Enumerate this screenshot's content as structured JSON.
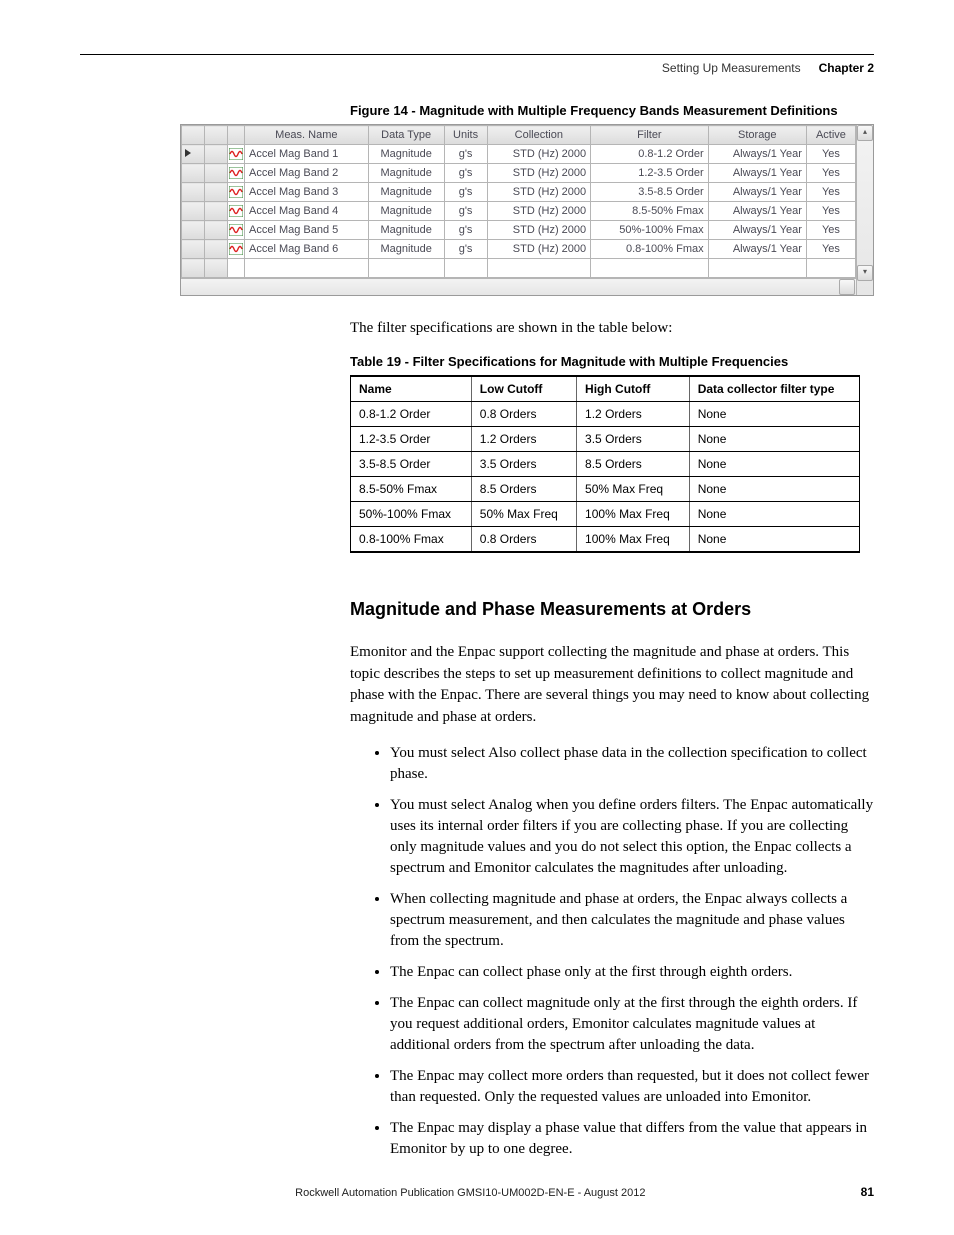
{
  "header": {
    "section": "Setting Up Measurements",
    "chapter": "Chapter 2"
  },
  "figure14": {
    "caption": "Figure 14 - Magnitude with Multiple Frequency Bands Measurement Definitions",
    "columns": [
      "Meas. Name",
      "Data Type",
      "Units",
      "Collection",
      "Filter",
      "Storage",
      "Active"
    ],
    "rows": [
      {
        "name": "Accel Mag Band 1",
        "dtype": "Magnitude",
        "units": "g's",
        "coll": "STD (Hz)  2000",
        "filter": "0.8-1.2 Order",
        "storage": "Always/1 Year",
        "active": "Yes",
        "selected": true
      },
      {
        "name": "Accel Mag Band 2",
        "dtype": "Magnitude",
        "units": "g's",
        "coll": "STD (Hz)  2000",
        "filter": "1.2-3.5 Order",
        "storage": "Always/1 Year",
        "active": "Yes",
        "selected": false
      },
      {
        "name": "Accel Mag Band 3",
        "dtype": "Magnitude",
        "units": "g's",
        "coll": "STD (Hz)  2000",
        "filter": "3.5-8.5 Order",
        "storage": "Always/1 Year",
        "active": "Yes",
        "selected": false
      },
      {
        "name": "Accel Mag Band 4",
        "dtype": "Magnitude",
        "units": "g's",
        "coll": "STD (Hz)  2000",
        "filter": "8.5-50% Fmax",
        "storage": "Always/1 Year",
        "active": "Yes",
        "selected": false
      },
      {
        "name": "Accel Mag Band 5",
        "dtype": "Magnitude",
        "units": "g's",
        "coll": "STD (Hz)  2000",
        "filter": "50%-100% Fmax",
        "storage": "Always/1 Year",
        "active": "Yes",
        "selected": false
      },
      {
        "name": "Accel Mag Band 6",
        "dtype": "Magnitude",
        "units": "g's",
        "coll": "STD (Hz)  2000",
        "filter": "0.8-100% Fmax",
        "storage": "Always/1 Year",
        "active": "Yes",
        "selected": false
      }
    ]
  },
  "para_after_fig": "The filter specifications are shown in the table below:",
  "table19": {
    "caption": "Table 19 - Filter Specifications for Magnitude with Multiple Frequencies",
    "headers": [
      "Name",
      "Low Cutoff",
      "High Cutoff",
      "Data collector filter type"
    ],
    "rows": [
      [
        "0.8-1.2 Order",
        "0.8 Orders",
        "1.2 Orders",
        "None"
      ],
      [
        "1.2-3.5 Order",
        "1.2 Orders",
        "3.5 Orders",
        "None"
      ],
      [
        "3.5-8.5 Order",
        "3.5 Orders",
        "8.5 Orders",
        "None"
      ],
      [
        "8.5-50% Fmax",
        "8.5 Orders",
        "50% Max Freq",
        "None"
      ],
      [
        "50%-100% Fmax",
        "50% Max Freq",
        "100% Max Freq",
        "None"
      ],
      [
        "0.8-100% Fmax",
        "0.8 Orders",
        "100% Max Freq",
        "None"
      ]
    ]
  },
  "section": {
    "heading": "Magnitude and Phase Measurements at Orders",
    "intro": "Emonitor and the Enpac support collecting the magnitude and phase at orders. This topic describes the steps to set up measurement definitions to collect magnitude and phase with the Enpac. There are several things you may need to know about collecting magnitude and phase at orders.",
    "bullets": [
      "You must select Also collect phase data in the collection specification to collect phase.",
      "You must select Analog when you define orders filters. The Enpac automatically uses its internal order filters if you are collecting phase. If you are collecting only magnitude values and you do not select this option, the Enpac collects a spectrum and Emonitor calculates the magnitudes after unloading.",
      "When collecting magnitude and phase at orders, the Enpac always collects a spectrum measurement, and then calculates the magnitude and phase values from the spectrum.",
      "The Enpac can collect phase only at the first through eighth orders.",
      "The Enpac can collect magnitude only at the first through the eighth orders. If you request additional orders, Emonitor calculates magnitude values at additional orders from the spectrum after unloading the data.",
      "The Enpac may collect more orders than requested, but it does not collect fewer than requested. Only the requested values are unloaded into Emonitor.",
      "The Enpac may display a phase value that differs from the value that appears in Emonitor by up to one degree."
    ]
  },
  "footer": {
    "publication": "Rockwell Automation Publication GMSI10-UM002D-EN-E - August 2012",
    "page": "81"
  }
}
